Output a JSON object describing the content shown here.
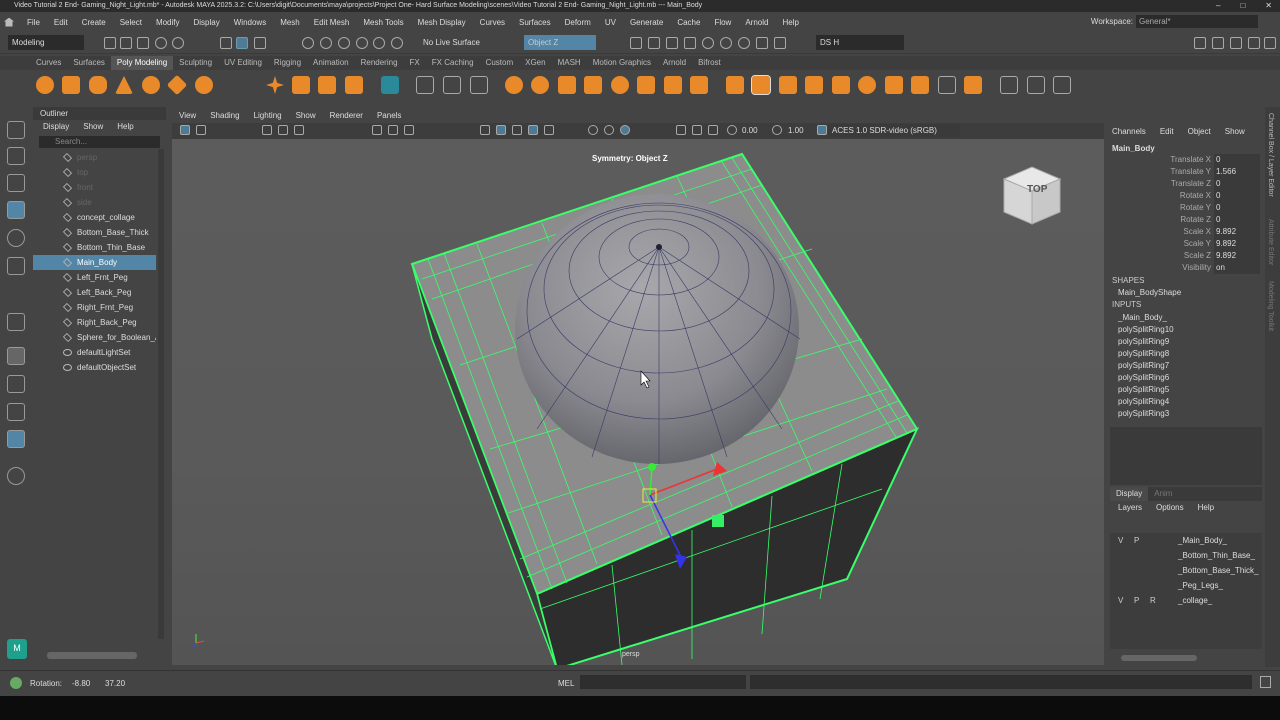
{
  "window": {
    "title": "Video Tutorial 2 End- Gaming_Night_Light.mb* - Autodesk MAYA 2025.3.2: C:\\Users\\digit\\Documents\\maya\\projects\\Project One- Hard Surface Modeling\\scenes\\Video Tutorial 2 End- Gaming_Night_Light.mb  ---  Main_Body",
    "min": "–",
    "max": "□",
    "close": "✕"
  },
  "menus": [
    "File",
    "Edit",
    "Create",
    "Select",
    "Modify",
    "Display",
    "Windows",
    "Mesh",
    "Edit Mesh",
    "Mesh Tools",
    "Mesh Display",
    "Curves",
    "Surfaces",
    "Deform",
    "UV",
    "Generate",
    "Cache",
    "Flow",
    "Arnold",
    "Help"
  ],
  "workspace": {
    "label": "Workspace:",
    "value": "General*"
  },
  "statusline": {
    "mode": "Modeling",
    "live_surface": "No Live Surface",
    "symmetry": "Object Z",
    "user": "DS H"
  },
  "shelf_tabs": [
    "Curves",
    "Surfaces",
    "Poly Modeling",
    "Sculpting",
    "UV Editing",
    "Rigging",
    "Animation",
    "Rendering",
    "FX",
    "FX Caching",
    "Custom",
    "XGen",
    "MASH",
    "Motion Graphics",
    "Arnold",
    "Bifrost"
  ],
  "shelf_active": "Poly Modeling",
  "outliner": {
    "title": "Outliner",
    "menu": [
      "Display",
      "Show",
      "Help"
    ],
    "search": "Search...",
    "items": [
      {
        "label": "persp",
        "dim": true
      },
      {
        "label": "top",
        "dim": true
      },
      {
        "label": "front",
        "dim": true
      },
      {
        "label": "side",
        "dim": true
      },
      {
        "label": "concept_collage"
      },
      {
        "label": "Bottom_Base_Thick"
      },
      {
        "label": "Bottom_Thin_Base"
      },
      {
        "label": "Main_Body",
        "selected": true
      },
      {
        "label": "Left_Frnt_Peg"
      },
      {
        "label": "Left_Back_Peg"
      },
      {
        "label": "Right_Frnt_Peg"
      },
      {
        "label": "Right_Back_Peg"
      },
      {
        "label": "Sphere_for_Boolean_A"
      },
      {
        "label": "defaultLightSet"
      },
      {
        "label": "defaultObjectSet"
      }
    ]
  },
  "viewport": {
    "menu": [
      "View",
      "Shading",
      "Lighting",
      "Show",
      "Renderer",
      "Panels"
    ],
    "exposure": "0.00",
    "gamma": "1.00",
    "colorspace": "ACES 1.0 SDR-video (sRGB)",
    "symmetry_label": "Symmetry: Object Z",
    "camera": "persp",
    "viewcube": "TOP"
  },
  "channelbox": {
    "tabs": [
      "Channels",
      "Edit",
      "Object",
      "Show"
    ],
    "object": "Main_Body",
    "attrs": [
      {
        "name": "Translate X",
        "value": "0"
      },
      {
        "name": "Translate Y",
        "value": "1.566"
      },
      {
        "name": "Translate Z",
        "value": "0"
      },
      {
        "name": "Rotate X",
        "value": "0"
      },
      {
        "name": "Rotate Y",
        "value": "0"
      },
      {
        "name": "Rotate Z",
        "value": "0"
      },
      {
        "name": "Scale X",
        "value": "9.892"
      },
      {
        "name": "Scale Y",
        "value": "9.892"
      },
      {
        "name": "Scale Z",
        "value": "9.892"
      },
      {
        "name": "Visibility",
        "value": "on"
      }
    ],
    "shapes_label": "SHAPES",
    "shape": "Main_BodyShape",
    "inputs_label": "INPUTS",
    "inputs": [
      "_Main_Body_",
      "polySplitRing10",
      "polySplitRing9",
      "polySplitRing8",
      "polySplitRing7",
      "polySplitRing6",
      "polySplitRing5",
      "polySplitRing4",
      "polySplitRing3"
    ]
  },
  "layers": {
    "tabs": [
      "Display",
      "Anim"
    ],
    "menu": [
      "Layers",
      "Options",
      "Help"
    ],
    "items": [
      {
        "v": "V",
        "p": "P",
        "r": "",
        "name": "_Main_Body_"
      },
      {
        "v": "",
        "p": "",
        "r": "",
        "name": "_Bottom_Thin_Base_"
      },
      {
        "v": "",
        "p": "",
        "r": "",
        "name": "_Bottom_Base_Thick_"
      },
      {
        "v": "",
        "p": "",
        "r": "",
        "name": "_Peg_Legs_"
      },
      {
        "v": "V",
        "p": "P",
        "r": "R",
        "name": "_collage_"
      }
    ]
  },
  "right_strip": [
    "Channel Box / Layer Editor",
    "Attribute Editor",
    "Modeling Toolkit"
  ],
  "bottom": {
    "rotation_label": "Rotation:",
    "rot_a": "-8.80",
    "rot_b": "37.20",
    "mel": "MEL"
  }
}
